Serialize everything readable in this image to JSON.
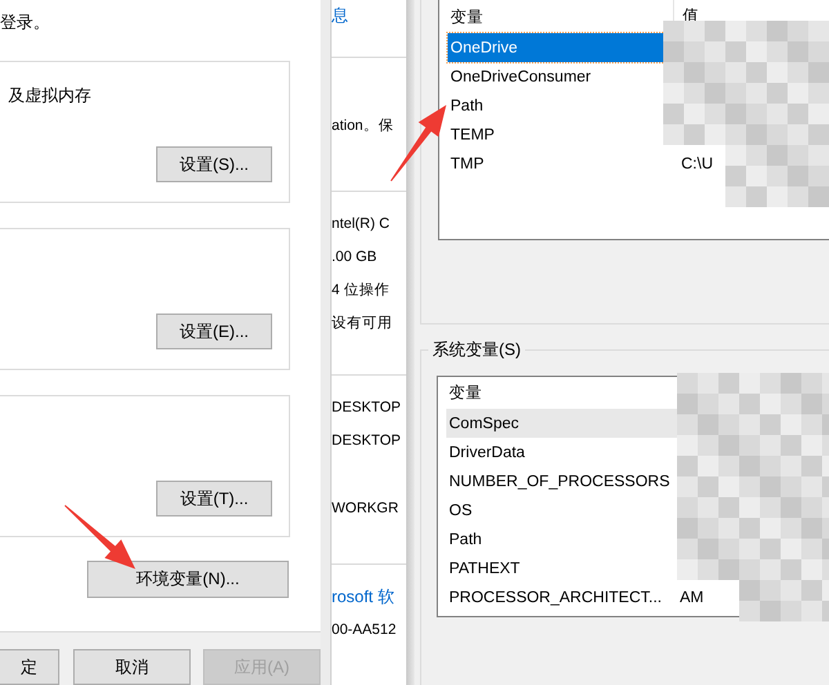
{
  "system_properties": {
    "intro_text": "登录。",
    "groups": [
      {
        "description": "及虚拟内存",
        "button": "设置(S)..."
      },
      {
        "button": "设置(E)..."
      },
      {
        "button": "设置(T)..."
      }
    ],
    "env_button": "环境变量(N)...",
    "footer_buttons": [
      {
        "label": "定",
        "disabled": false
      },
      {
        "label": "取消",
        "disabled": false
      },
      {
        "label": "应用(A)",
        "disabled": true
      }
    ]
  },
  "system_info": {
    "sections": [
      {
        "lines": [
          {
            "text": "息",
            "kind": "link"
          }
        ]
      },
      {
        "lines": [
          {
            "text": "ation。保",
            "kind": "text"
          }
        ]
      },
      {
        "lines": [
          {
            "text": "ntel(R) C",
            "kind": "text"
          },
          {
            "text": ".00 GB",
            "kind": "text"
          },
          {
            "text": "4 位操作",
            "kind": "text"
          },
          {
            "text": "设有可用",
            "kind": "text"
          }
        ]
      },
      {
        "lines": [
          {
            "text": "DESKTOP",
            "kind": "text"
          },
          {
            "text": "DESKTOP",
            "kind": "text"
          },
          {
            "text": "WORKGR",
            "kind": "text"
          }
        ]
      },
      {
        "lines": [
          {
            "text": "rosoft 软",
            "kind": "link"
          },
          {
            "text": "00-AA512",
            "kind": "text"
          }
        ]
      }
    ]
  },
  "environment_variables": {
    "user_variables": {
      "columns": [
        "变量",
        "值"
      ],
      "rows": [
        {
          "name": "OneDrive",
          "selected": true
        },
        {
          "name": "OneDriveConsumer",
          "selected": false
        },
        {
          "name": "Path",
          "selected": false
        },
        {
          "name": "TEMP",
          "selected": false
        },
        {
          "name": "TMP",
          "value": "C:\\U",
          "selected": false
        }
      ]
    },
    "system_variables": {
      "label": "系统变量(S)",
      "columns": [
        "变量"
      ],
      "rows": [
        {
          "name": "ComSpec",
          "hovered": true
        },
        {
          "name": "DriverData",
          "hovered": false
        },
        {
          "name": "NUMBER_OF_PROCESSORS",
          "hovered": false
        },
        {
          "name": "OS",
          "hovered": false
        },
        {
          "name": "Path",
          "hovered": false
        },
        {
          "name": "PATHEXT",
          "hovered": false
        },
        {
          "name": "PROCESSOR_ARCHITECT...",
          "value": "AM",
          "hovered": false
        }
      ]
    }
  }
}
